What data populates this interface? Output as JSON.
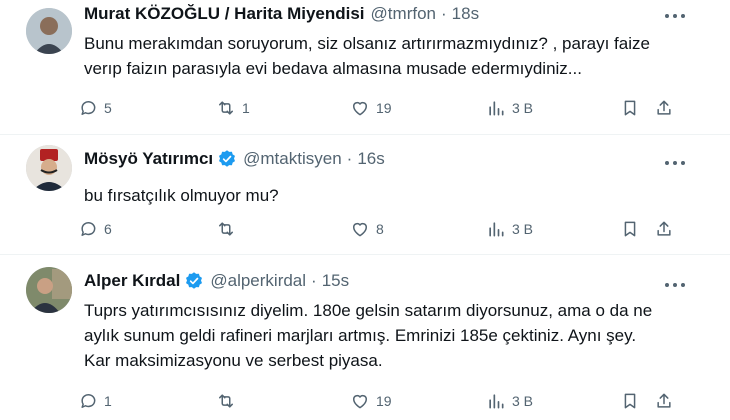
{
  "tweets": [
    {
      "name": "Murat KÖZOĞLU / Harita Miyendisi",
      "handle": "@tmrfon",
      "time": "18s",
      "lines": [
        "Bunu merakımdan soruyorum, siz olsanız artırırmazmıydınız? , parayı faize",
        "verıp faizın parasıyla evi bedava almasına musade edermıydiniz..."
      ],
      "replies": "5",
      "retweets": "1",
      "likes": "19",
      "views": "3 B"
    },
    {
      "name": "Mösyö Yatırımcı",
      "handle": "@mtaktisyen",
      "time": "16s",
      "verified": true,
      "lines": [
        "bu fırsatçılık olmuyor mu?"
      ],
      "replies": "6",
      "retweets": "",
      "likes": "8",
      "views": "3 B"
    },
    {
      "name": "Alper Kırdal",
      "handle": "@alperkirdal",
      "time": "15s",
      "verified": true,
      "lines": [
        "Tuprs yatırımcısısınız diyelim. 180e gelsin satarım diyorsunuz, ama o da ne",
        "aylık sunum geldi rafineri marjları artmış. Emrinizi 185e çektiniz. Aynı şey.",
        "Kar maksimizasyonu ve serbest piyasa."
      ],
      "replies": "1",
      "retweets": "",
      "likes": "19",
      "views": "3 B"
    }
  ],
  "colors": {
    "text": "#0f1419",
    "muted": "#536471",
    "verified": "#1d9bf0",
    "divider": "#eff3f4"
  },
  "icons": [
    "reply-icon",
    "retweet-icon",
    "like-icon",
    "views-icon",
    "bookmark-icon",
    "share-icon",
    "more-icon",
    "verified-badge-icon"
  ]
}
